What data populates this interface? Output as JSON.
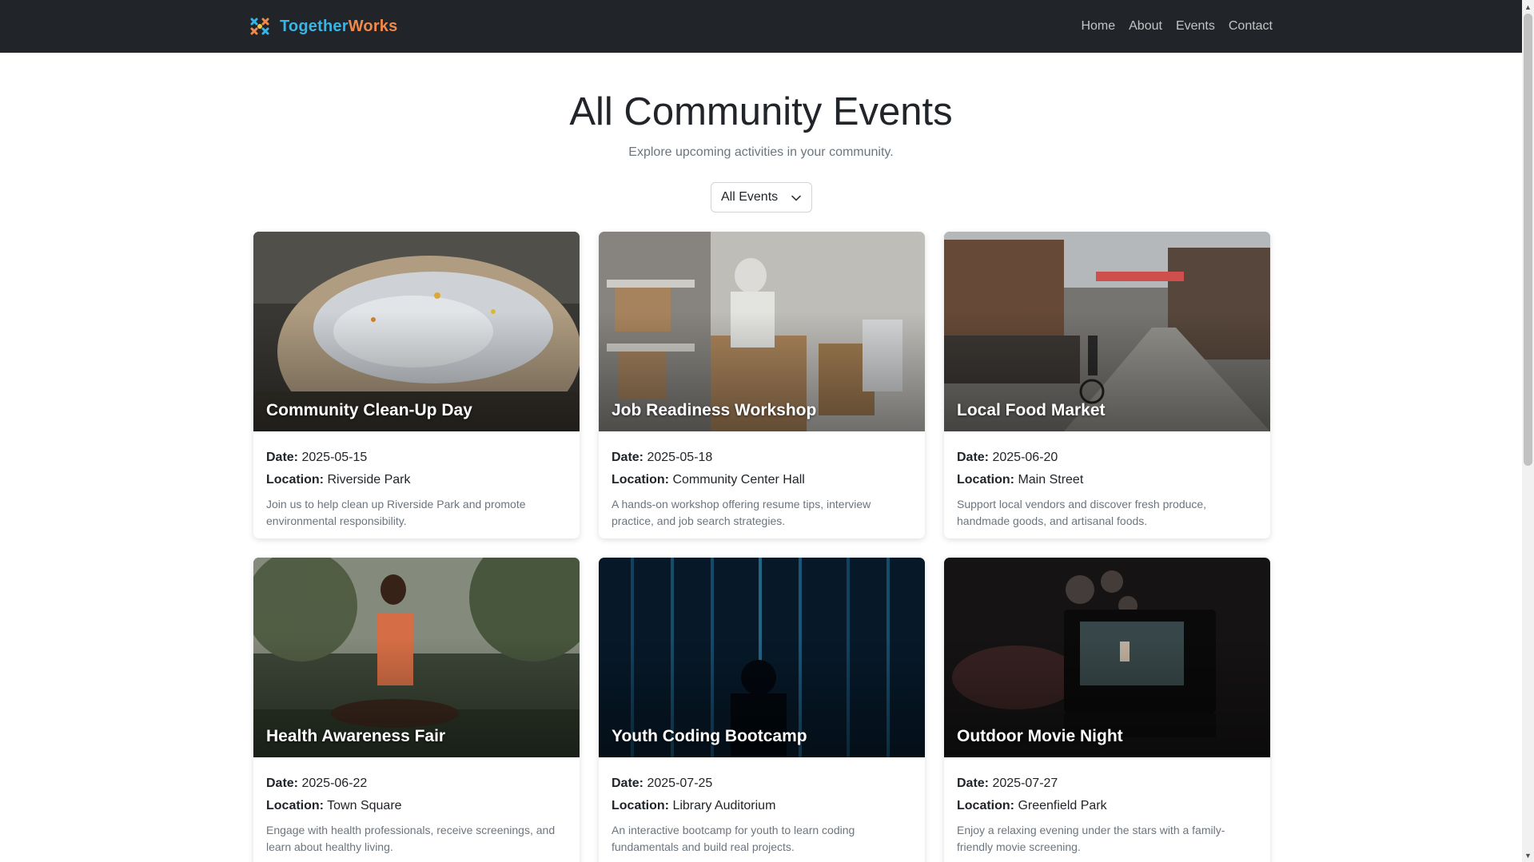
{
  "brand": {
    "part1": "Together",
    "part2": "Works",
    "colors": {
      "part1": "#35b6e8",
      "part2": "#f08a4b"
    }
  },
  "nav": {
    "items": [
      "Home",
      "About",
      "Events",
      "Contact"
    ]
  },
  "header": {
    "title": "All Community Events",
    "subtitle": "Explore upcoming activities in your community."
  },
  "filter": {
    "selected": "All Events"
  },
  "labels": {
    "date": "Date:",
    "location": "Location:"
  },
  "events": [
    {
      "title": "Community Clean-Up Day",
      "date": "2025-05-15",
      "location": "Riverside Park",
      "description": "Join us to help clean up Riverside Park and promote environmental responsibility."
    },
    {
      "title": "Job Readiness Workshop",
      "date": "2025-05-18",
      "location": "Community Center Hall",
      "description": "A hands-on workshop offering resume tips, interview practice, and job search strategies."
    },
    {
      "title": "Local Food Market",
      "date": "2025-06-20",
      "location": "Main Street",
      "description": "Support local vendors and discover fresh produce, handmade goods, and artisanal foods."
    },
    {
      "title": "Health Awareness Fair",
      "date": "2025-06-22",
      "location": "Town Square",
      "description": "Engage with health professionals, receive screenings, and learn about healthy living."
    },
    {
      "title": "Youth Coding Bootcamp",
      "date": "2025-07-25",
      "location": "Library Auditorium",
      "description": "An interactive bootcamp for youth to learn coding fundamentals and build real projects."
    },
    {
      "title": "Outdoor Movie Night",
      "date": "2025-07-27",
      "location": "Greenfield Park",
      "description": "Enjoy a relaxing evening under the stars with a family-friendly movie screening."
    }
  ]
}
